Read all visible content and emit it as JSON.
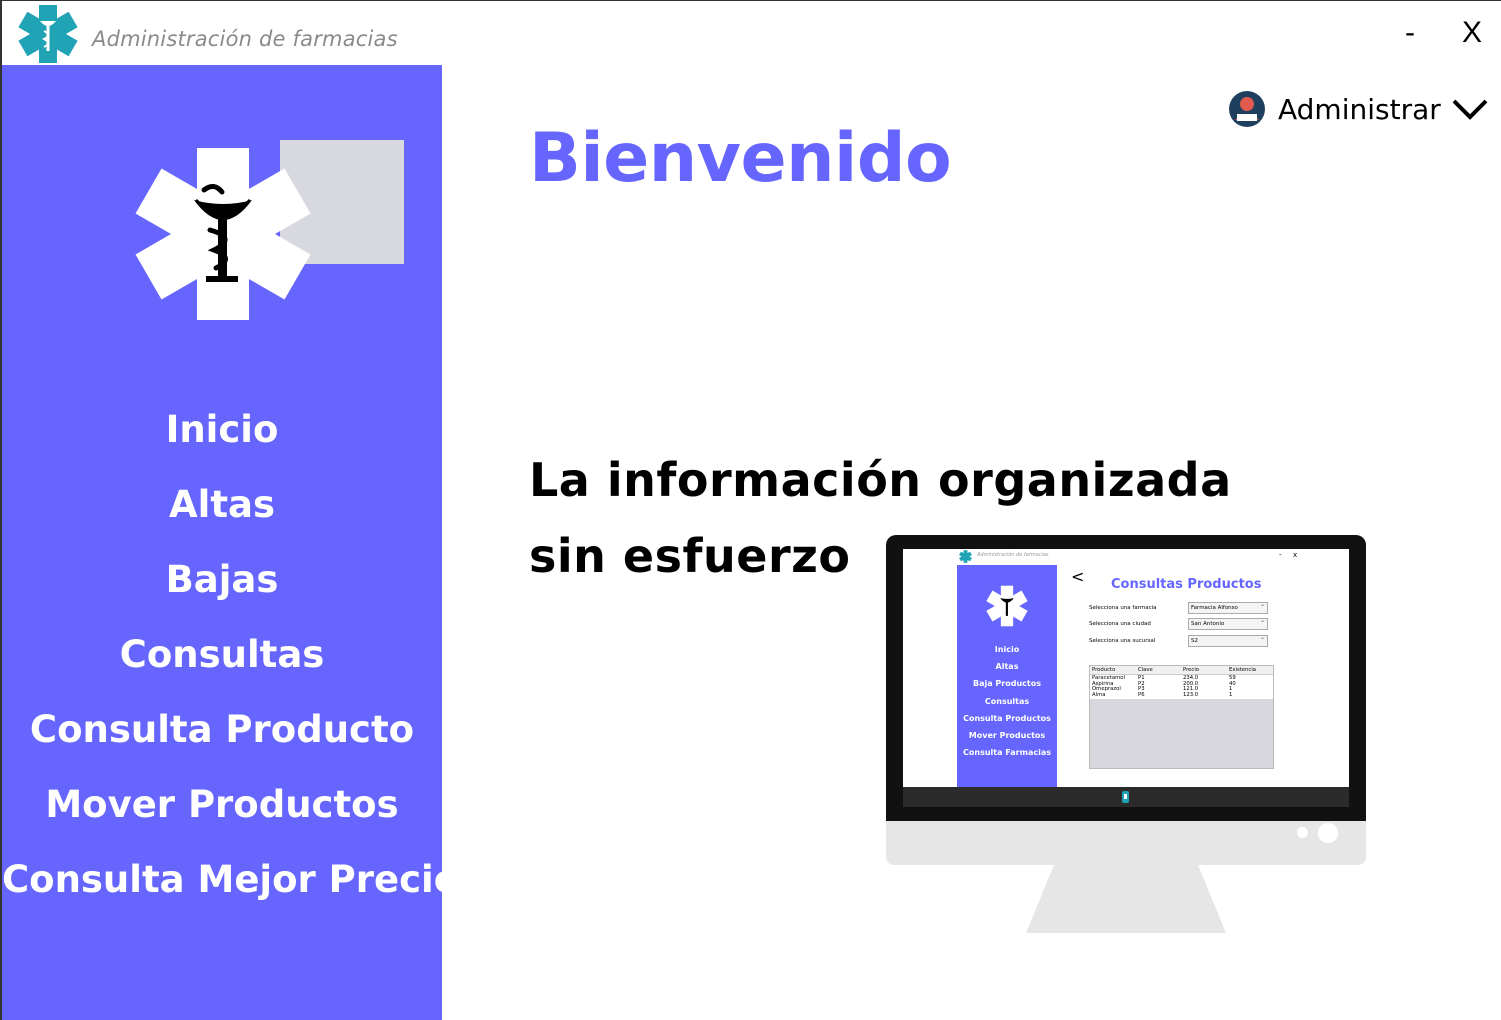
{
  "window": {
    "title": "Administración de farmacias",
    "minimize_label": "-",
    "close_label": "X"
  },
  "sidebar": {
    "items": [
      {
        "label": "Inicio"
      },
      {
        "label": "Altas"
      },
      {
        "label": "Bajas"
      },
      {
        "label": "Consultas"
      },
      {
        "label": "Consulta Producto"
      },
      {
        "label": "Mover Productos"
      },
      {
        "label": "Consulta Mejor Precio"
      }
    ]
  },
  "header": {
    "user_label": "Administrar",
    "user_icon": "user-avatar-icon",
    "menu_icon": "chevron-down-icon"
  },
  "main": {
    "welcome": "Bienvenido",
    "tagline_line1": "La información organizada",
    "tagline_line2": "sin esfuerzo"
  },
  "screenshot_preview": {
    "app_title": "Administración de farmacias",
    "win_min": "-",
    "win_close": "x",
    "back_label": "<",
    "heading": "Consultas Productos",
    "nav": [
      "Inicio",
      "Altas",
      "Baja Productos",
      "Consultas",
      "Consulta Productos",
      "Mover Productos",
      "Consulta Farmacias"
    ],
    "form": [
      {
        "label": "Selecciona una farmacia",
        "value": "Farmacia Alfonso"
      },
      {
        "label": "Selecciona una ciudad",
        "value": "San Antonio"
      },
      {
        "label": "Selecciona una sucursal",
        "value": "S2"
      }
    ],
    "table": {
      "columns": [
        "Producto",
        "Clave",
        "Precio",
        "Existencia"
      ],
      "rows": [
        [
          "Paracetamol",
          "P1",
          "234.0",
          "59"
        ],
        [
          "Aspirina",
          "P2",
          "200.0",
          "40"
        ],
        [
          "Omeprazol",
          "P3",
          "121.0",
          "1"
        ],
        [
          "Alma",
          "P6",
          "123.0",
          "1"
        ]
      ]
    }
  },
  "colors": {
    "accent": "#6666ff",
    "sidebar_bg": "#6666ff",
    "logo_teal": "#1fa3b5"
  }
}
